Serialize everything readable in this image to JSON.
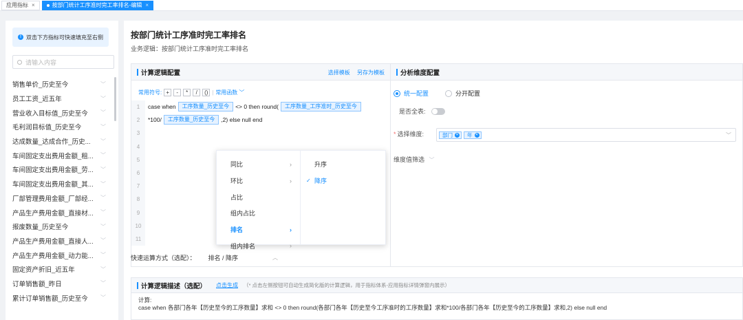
{
  "tabs": [
    {
      "label": "应用指标",
      "active": false
    },
    {
      "label": "按部门统计工序准时完工率排名-编辑",
      "active": true
    }
  ],
  "sidebar": {
    "hint": "双击下方指标可快速填充至右侧",
    "search_placeholder": "请输入内容",
    "items": [
      "销售单价_历史至今",
      "员工工资_近五年",
      "营业收入目标值_历史至今",
      "毛利润目标值_历史至今",
      "达成数量_达成合作_历史...",
      "车间固定支出费用金额_租...",
      "车间固定支出费用金额_劳...",
      "车间固定支出费用金额_其...",
      "厂部管理费用金额_厂部经...",
      "产品生产费用金额_直接材...",
      "报废数量_历史至今",
      "产品生产费用金额_直接人...",
      "产品生产费用金额_动力能...",
      "固定资产折旧_近五年",
      "订单销售额_昨日",
      "累计订单销售额_历史至今"
    ]
  },
  "main": {
    "title": "按部门统计工序准时完工率排名",
    "subtitle": "业务逻辑：按部门统计工序准时完工率排名"
  },
  "calc": {
    "title": "计算逻辑配置",
    "link_template": "选择模板",
    "link_save": "另存为模板",
    "symbols_label": "常用符号:",
    "symbols": [
      "+",
      "-",
      "*",
      "/",
      "()"
    ],
    "functions_label": "常用函数",
    "line_numbers": [
      "1",
      "2",
      "3",
      "4",
      "5",
      "6",
      "7",
      "8",
      "9",
      "10",
      "11"
    ],
    "line1_a": "case when",
    "line1_chip1": "工序数量_历史至今",
    "line1_b": "<> 0 then  round(",
    "line1_chip2": "工序数量_工序准时_历史至今",
    "line2_a": "*100/",
    "line2_chip": "工序数量_历史至今",
    "line2_b": ",2) else null end",
    "quick_label": "快速运算方式（选配）：",
    "quick_value": "排名 / 降序"
  },
  "context_menu": {
    "items": [
      "同比",
      "环比",
      "占比",
      "组内占比",
      "排名",
      "组内排名"
    ],
    "active": "排名",
    "sub_items": [
      "升序",
      "降序"
    ],
    "sub_selected": "降序"
  },
  "dim": {
    "title": "分析维度配置",
    "radio_unified": "统一配置",
    "radio_separate": "分开配置",
    "full_table_label": "是否全表:",
    "select_label": "选择维度:",
    "chips": [
      "部门",
      "年"
    ],
    "filter_label": "维度值筛选"
  },
  "desc": {
    "title": "计算逻辑描述（选配）",
    "generate": "点击生成",
    "note": "（* 点击左侧按钮可自动生成简化版的计算逻辑，用于指标体系-应用指标详情弹窗内展示）",
    "calc_label": "计算:",
    "text": "case when 各部门各年【历史至今的工序数量】求和 <> 0 then  round(各部门各年【历史至今工序准时的工序数量】求和*100/各部门各年【历史至今的工序数量】求和,2) else null end"
  }
}
